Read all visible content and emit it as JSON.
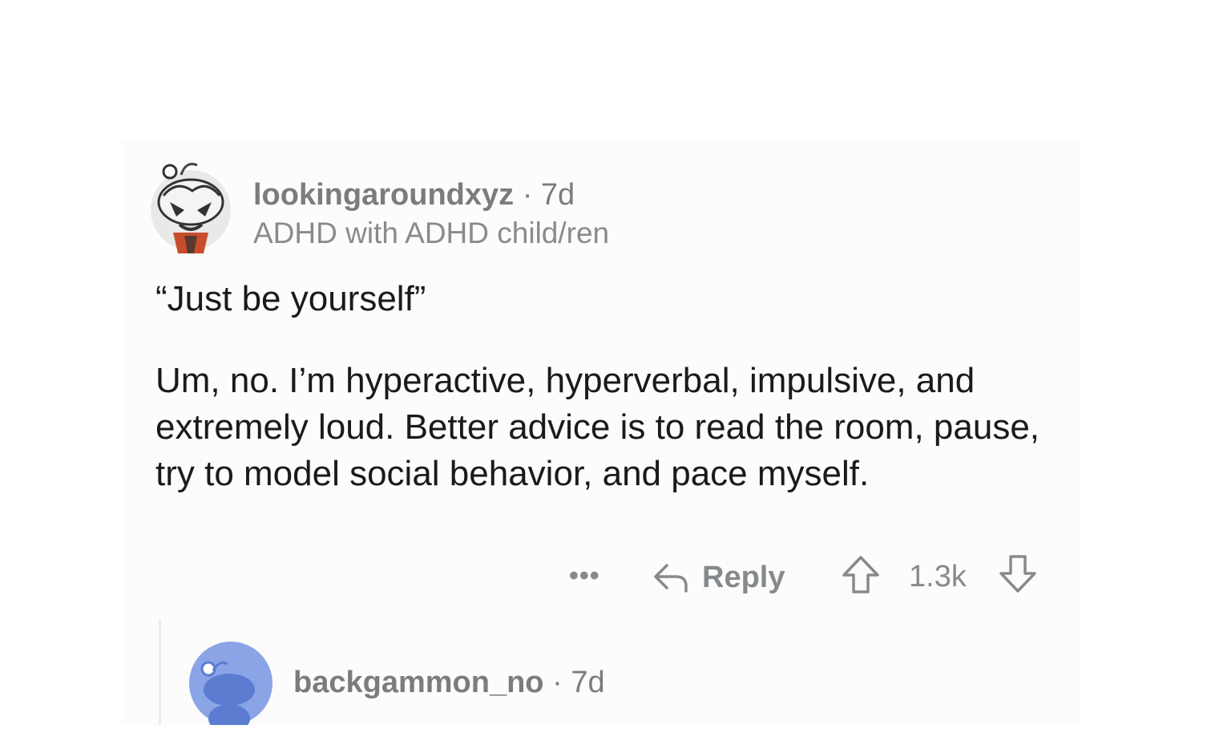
{
  "comment": {
    "username": "lookingaroundxyz",
    "separator": " · ",
    "age": "7d",
    "flair": "ADHD with ADHD child/ren",
    "quote": "“Just be yourself”",
    "paragraph": "Um, no. I’m hyperactive, hyperverbal, impulsive, and extremely loud. Better advice is to read the room, pause, try to model social behavior, and pace myself.",
    "actions": {
      "more": "•••",
      "reply": "Reply",
      "score": "1.3k"
    }
  },
  "reply": {
    "username": "backgammon_no",
    "separator": " · ",
    "age": "7d"
  },
  "icons": {
    "main_avatar": "reddit-snoo-avatar-icon",
    "reply_avatar": "reddit-default-avatar-icon",
    "reply": "reply-arrow-icon",
    "upvote": "upvote-arrow-icon",
    "downvote": "downvote-arrow-icon"
  },
  "colors": {
    "text_primary": "#1a1a1b",
    "text_secondary": "#7c7c7c",
    "icon_gray": "#878a8c",
    "reply_avatar_bg": "#8aa4e6"
  }
}
